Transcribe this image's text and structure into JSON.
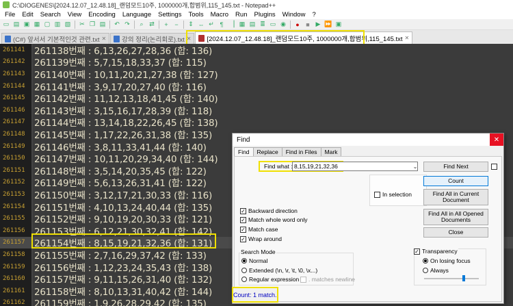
{
  "window": {
    "title": "C:\\DIOGENES\\[2024.12.07_12.48.18]_랜덤모드10주, 1000000개,합범위,115_145.txt - Notepad++"
  },
  "menubar": [
    "File",
    "Edit",
    "Search",
    "View",
    "Encoding",
    "Language",
    "Settings",
    "Tools",
    "Macro",
    "Run",
    "Plugins",
    "Window",
    "?"
  ],
  "tabs": [
    {
      "label": "(C#) 앞서서 기본적인것 관련.txt",
      "active": false
    },
    {
      "label": "강의 정리(논리회로).txt",
      "active": false
    },
    {
      "label": "[2024.12.07_12.48.18]_랜덤모드10주, 1000000개,합범위,115_145.txt",
      "active": true
    }
  ],
  "editor": {
    "lines": [
      {
        "num": "261141",
        "text": "261138번째 : 6,13,26,27,28,36   (합: 136)"
      },
      {
        "num": "261142",
        "text": "261139번째 : 5,7,15,18,33,37 (합: 115)"
      },
      {
        "num": "261143",
        "text": "261140번째 : 10,11,20,21,27,38 (합: 127)"
      },
      {
        "num": "261144",
        "text": "261141번째 : 3,9,17,20,27,40 (합: 116)"
      },
      {
        "num": "261145",
        "text": "261142번째 : 11,12,13,18,41,45 (합: 140)"
      },
      {
        "num": "261146",
        "text": "261143번째 : 3,15,16,17,28,39  (합: 118)"
      },
      {
        "num": "261147",
        "text": "261144번째 : 13,14,18,22,26,45 (합: 138)"
      },
      {
        "num": "261148",
        "text": "261145번째 : 1,17,22,26,31,38  (합: 135)"
      },
      {
        "num": "261149",
        "text": "261146번째 : 3,8,11,33,41,44  (합: 140)"
      },
      {
        "num": "261150",
        "text": "261147번째 : 10,11,20,29,34,40 (합: 144)"
      },
      {
        "num": "261151",
        "text": "261148번째 : 3,5,14,20,35,45  (합: 122)"
      },
      {
        "num": "261152",
        "text": "261149번째 : 5,6,13,26,31,41  (합: 122)"
      },
      {
        "num": "261153",
        "text": "261150번째 : 3,12,17,21,30,33   (합: 116)"
      },
      {
        "num": "261154",
        "text": "261151번째 : 4,10,13,24,40,44   (합: 135)"
      },
      {
        "num": "261155",
        "text": "261152번째 : 9,10,19,20,30,33   (합: 121)"
      },
      {
        "num": "261156",
        "text": "261153번째 : 6,12,21,30,32,41   (합: 142)"
      },
      {
        "num": "261157",
        "text": "261154번째 : 8,15,19,21,32,36   (합: 131)",
        "current": true
      },
      {
        "num": "261158",
        "text": "261155번째 : 2,7,16,29,37,42  (합: 133)"
      },
      {
        "num": "261159",
        "text": "261156번째 : 1,12,23,24,35,43  (합: 138)"
      },
      {
        "num": "261160",
        "text": "261157번째 : 9,11,15,26,31,40  (합: 132)"
      },
      {
        "num": "261161",
        "text": "261158번째 : 8,10,13,31,40,42  (합: 144)"
      },
      {
        "num": "261162",
        "text": "261159번째 : 1,9,26,28,29,42  (합: 135)"
      }
    ]
  },
  "find_dialog": {
    "title": "Find",
    "close": "✕",
    "tabs": [
      "Find",
      "Replace",
      "Find in Files",
      "Mark"
    ],
    "find_what_label": "Find what :",
    "find_what_value": "8,15,19,21,32,36",
    "buttons": {
      "find_next": "Find Next",
      "count": "Count",
      "find_all_current": "Find All in Current Document",
      "find_all_opened": "Find All in All Opened Documents",
      "close": "Close"
    },
    "in_selection": "In selection",
    "options": [
      {
        "label": "Backward direction",
        "checked": true
      },
      {
        "label": "Match whole word only",
        "checked": true
      },
      {
        "label": "Match case",
        "checked": true
      },
      {
        "label": "Wrap around",
        "checked": true
      }
    ],
    "search_mode": {
      "label": "Search Mode",
      "normal": "Normal",
      "extended": "Extended (\\n, \\r, \\t, \\0, \\x...)",
      "regex": "Regular expression",
      "matches_newline": ". matches newline",
      "selected": "Normal"
    },
    "transparency": {
      "label": "Transparency",
      "checked": true,
      "on_losing_focus": "On losing focus",
      "always": "Always",
      "selected": "On losing focus",
      "level": 0.72
    },
    "status": "Count: 1 match."
  },
  "colors": {
    "highlight": "#f0e000",
    "editor_text": "#e8e2c8",
    "line_number": "#c8a032",
    "close_red": "#e81123"
  }
}
